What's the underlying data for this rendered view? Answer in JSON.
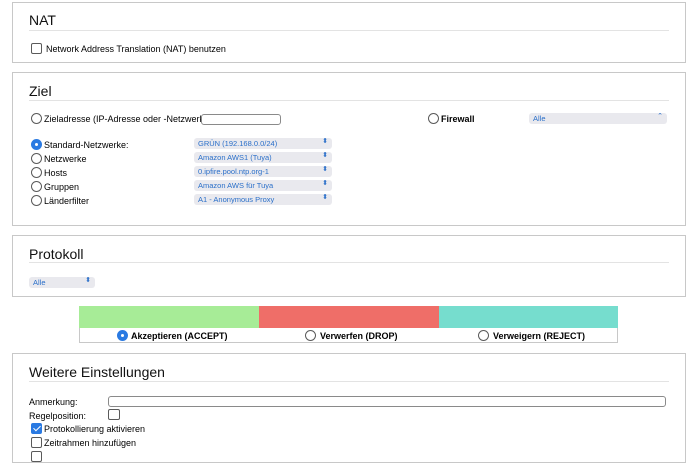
{
  "nat": {
    "title": "NAT",
    "checkbox_label": "Network Address Translation (NAT) benutzen",
    "checked": false
  },
  "ziel": {
    "title": "Ziel",
    "zieladresse_label": "Zieladresse (IP-Adresse oder -Netzwerk):",
    "zieladresse_value": "",
    "firewall_label": "Firewall",
    "firewall_select": "Alle",
    "rows": [
      {
        "label": "Standard-Netzwerke:",
        "value": "GRÜN (192.168.0.0/24)",
        "selected": true
      },
      {
        "label": "Netzwerke",
        "value": "Amazon AWS1 (Tuya)",
        "selected": false
      },
      {
        "label": "Hosts",
        "value": "0.ipfire.pool.ntp.org-1",
        "selected": false
      },
      {
        "label": "Gruppen",
        "value": "Amazon AWS für Tuya",
        "selected": false
      },
      {
        "label": "Länderfilter",
        "value": "A1 - Anonymous Proxy",
        "selected": false
      }
    ]
  },
  "protokoll": {
    "title": "Protokoll",
    "select": "Alle"
  },
  "actions": {
    "accept_label": "Akzeptieren (ACCEPT)",
    "drop_label": "Verwerfen (DROP)",
    "reject_label": "Verweigern (REJECT)",
    "accept_color": "#a7ec97",
    "drop_color": "#ef6e68",
    "reject_color": "#76ddce",
    "selected": "accept"
  },
  "weitere": {
    "title": "Weitere Einstellungen",
    "anmerkung_label": "Anmerkung:",
    "anmerkung_value": "",
    "regelposition_label": "Regelposition:",
    "protokollierung_label": "Protokollierung aktivieren",
    "protokollierung_checked": true,
    "zeitrahmen_label": "Zeitrahmen hinzufügen",
    "zeitrahmen_checked": false
  },
  "colors": {
    "accent": "#2a7ae2",
    "select_text": "#2a6fc9",
    "border": "#c8c8c8"
  }
}
